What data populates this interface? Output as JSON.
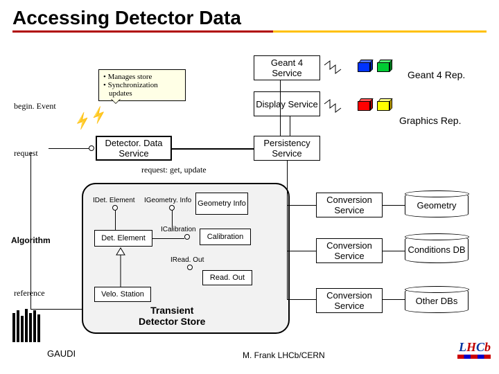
{
  "title": "Accessing Detector Data",
  "callout": {
    "line1": "• Manages store",
    "line2": "• Synchronization",
    "line3": "updates"
  },
  "labels": {
    "beginEvent": "begin. Event",
    "request": "request",
    "algorithm": "Algorithm",
    "reference": "reference",
    "gaudi": "GAUDI",
    "footer": "M. Frank LHCb/CERN",
    "requestEdge": "request: get, update",
    "tdsTitle1": "Transient",
    "tdsTitle2": "Detector Store"
  },
  "services": {
    "detectorData": "Detector. Data Service",
    "geant4": "Geant 4 Service",
    "display": "Display Service",
    "persistency": "Persistency Service",
    "conv1": "Conversion Service",
    "conv2": "Conversion Service",
    "conv3": "Conversion Service"
  },
  "reps": {
    "geant4": "Geant 4 Rep.",
    "graphics": "Graphics Rep."
  },
  "dbs": {
    "geometry": "Geometry",
    "conditions": "Conditions DB",
    "other": "Other DBs"
  },
  "tds": {
    "idet": "IDet. Element",
    "igeo": "IGeometry. Info",
    "geoInfo": "Geometry Info",
    "detElem": "Det. Element",
    "ical": "ICalibration",
    "calib": "Calibration",
    "iread": "IRead. Out",
    "readout": "Read. Out",
    "velo": "Velo. Station"
  },
  "cubes": {
    "g4a": "#0033ff",
    "g4b": "#00cc33",
    "gra": "#ff0000",
    "grb": "#ffff00"
  }
}
